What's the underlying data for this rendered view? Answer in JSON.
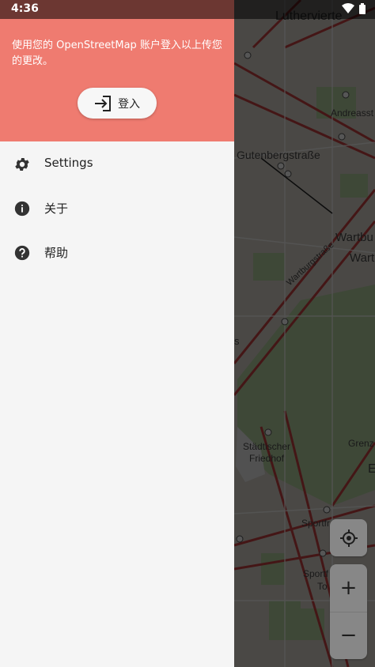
{
  "status_bar": {
    "time": "4:36",
    "icons": [
      "wifi-icon",
      "battery-icon"
    ]
  },
  "drawer": {
    "header": {
      "message": "使用您的 OpenStreetMap 账户登入以上传您的更改。",
      "login_button": {
        "label": "登入",
        "icon": "login-icon"
      }
    },
    "menu": [
      {
        "label": "Settings",
        "icon": "gear-icon"
      },
      {
        "label": "关于",
        "icon": "info-icon"
      },
      {
        "label": "帮助",
        "icon": "help-icon"
      }
    ],
    "colors": {
      "header_bg": "#ef7b70",
      "drawer_bg": "#f5f5f5"
    }
  },
  "map": {
    "labels": [
      "Luthervierte",
      "Andreasst",
      "Gutenbergstraße",
      "Wartbu",
      "Wart",
      "Wartburgstraße",
      "s",
      "Städtischer",
      "Friedhof",
      "Grenz",
      "E",
      "Sportfr",
      "Sportf",
      "To"
    ],
    "controls": {
      "locate": "gps-icon",
      "zoom_in": "+",
      "zoom_out": "−"
    }
  }
}
